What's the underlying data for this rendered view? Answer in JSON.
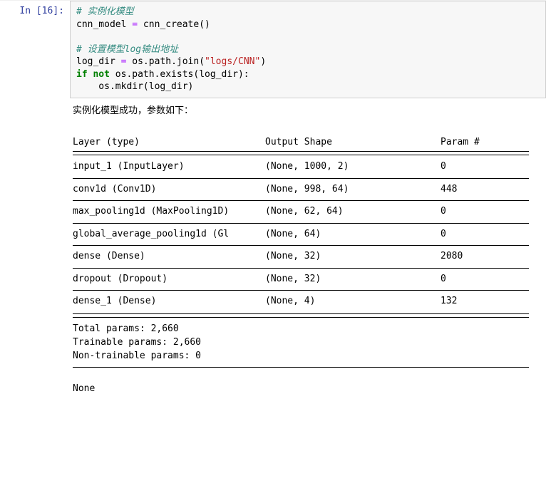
{
  "prompt": "In  [16]:",
  "code": {
    "c1": "# 实例化模型",
    "l2_a": "cnn_model ",
    "l2_op": "=",
    "l2_b": " cnn_create()",
    "blank1": "",
    "c2": "# 设置模型log输出地址",
    "l4_a": "log_dir ",
    "l4_op": "=",
    "l4_b1": " os.path.join(",
    "l4_str": "\"logs/CNN\"",
    "l4_b2": ")",
    "l5_kw1": "if",
    "l5_sp": " ",
    "l5_kw2": "not",
    "l5_rest": " os.path.exists(log_dir):",
    "l6": "    os.mkdir(log_dir)"
  },
  "output": {
    "line1": "实例化模型成功，参数如下：",
    "header": {
      "layer": "Layer (type)",
      "shape": "Output Shape",
      "param": "Param #"
    },
    "rows": [
      {
        "layer": "input_1 (InputLayer)",
        "shape": "(None, 1000, 2)",
        "param": "0"
      },
      {
        "layer": "conv1d (Conv1D)",
        "shape": "(None, 998, 64)",
        "param": "448"
      },
      {
        "layer": "max_pooling1d (MaxPooling1D)",
        "shape": "(None, 62, 64)",
        "param": "0"
      },
      {
        "layer": "global_average_pooling1d (Gl",
        "shape": "(None, 64)",
        "param": "0"
      },
      {
        "layer": "dense (Dense)",
        "shape": "(None, 32)",
        "param": "2080"
      },
      {
        "layer": "dropout (Dropout)",
        "shape": "(None, 32)",
        "param": "0"
      },
      {
        "layer": "dense_1 (Dense)",
        "shape": "(None, 4)",
        "param": "132"
      }
    ],
    "total": "Total params: 2,660",
    "trainable": "Trainable params: 2,660",
    "nontrain": "Non-trainable params: 0",
    "tail": "None"
  }
}
